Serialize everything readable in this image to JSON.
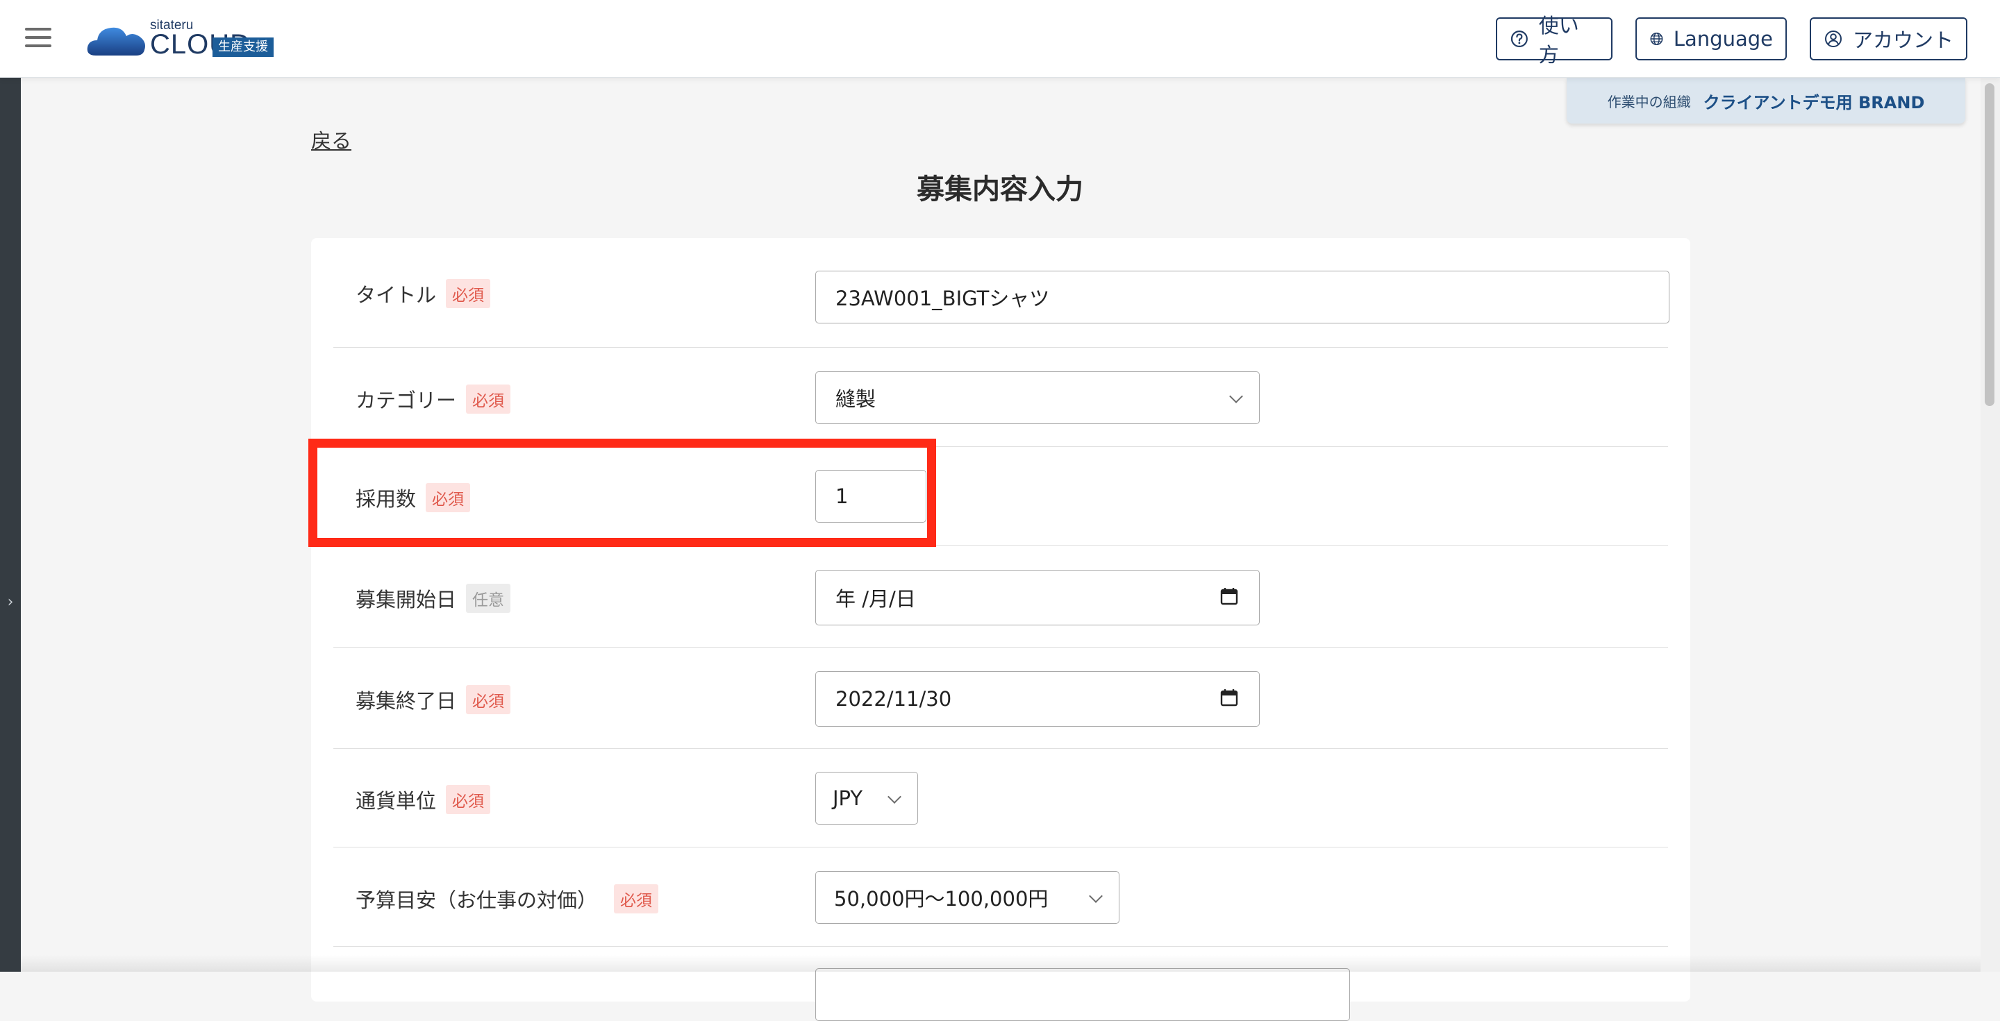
{
  "header": {
    "logo_small": "sitateru",
    "logo_main": "CLOUD",
    "logo_badge": "生産支援",
    "help_label": "使い方",
    "language_label": "Language",
    "account_label": "アカウント"
  },
  "org": {
    "label": "作業中の組織",
    "name": "クライアントデモ用 BRAND"
  },
  "page": {
    "back_label": "戻る",
    "title": "募集内容入力"
  },
  "badges": {
    "required": "必須",
    "optional": "任意"
  },
  "form": {
    "title": {
      "label": "タイトル",
      "value": "23AW001_BIGTシャツ"
    },
    "category": {
      "label": "カテゴリー",
      "value": "縫製"
    },
    "hires": {
      "label": "採用数",
      "value": "1"
    },
    "start_date": {
      "label": "募集開始日",
      "value": "年 /月/日"
    },
    "end_date": {
      "label": "募集終了日",
      "value": "2022/11/30"
    },
    "currency": {
      "label": "通貨単位",
      "value": "JPY"
    },
    "budget": {
      "label": "予算目安（お仕事の対価）",
      "value": "50,000円〜100,000円"
    }
  },
  "colors": {
    "brand_navy": "#1f3a63",
    "badge_required_bg": "#fde3e1",
    "badge_required_text": "#e05a4d",
    "highlight_red": "#ff2a17"
  },
  "icons": {
    "menu": "hamburger-icon",
    "help": "question-circle-icon",
    "language": "globe-icon",
    "account": "user-circle-icon",
    "calendar": "calendar-icon",
    "chevron": "chevron-down-icon"
  }
}
